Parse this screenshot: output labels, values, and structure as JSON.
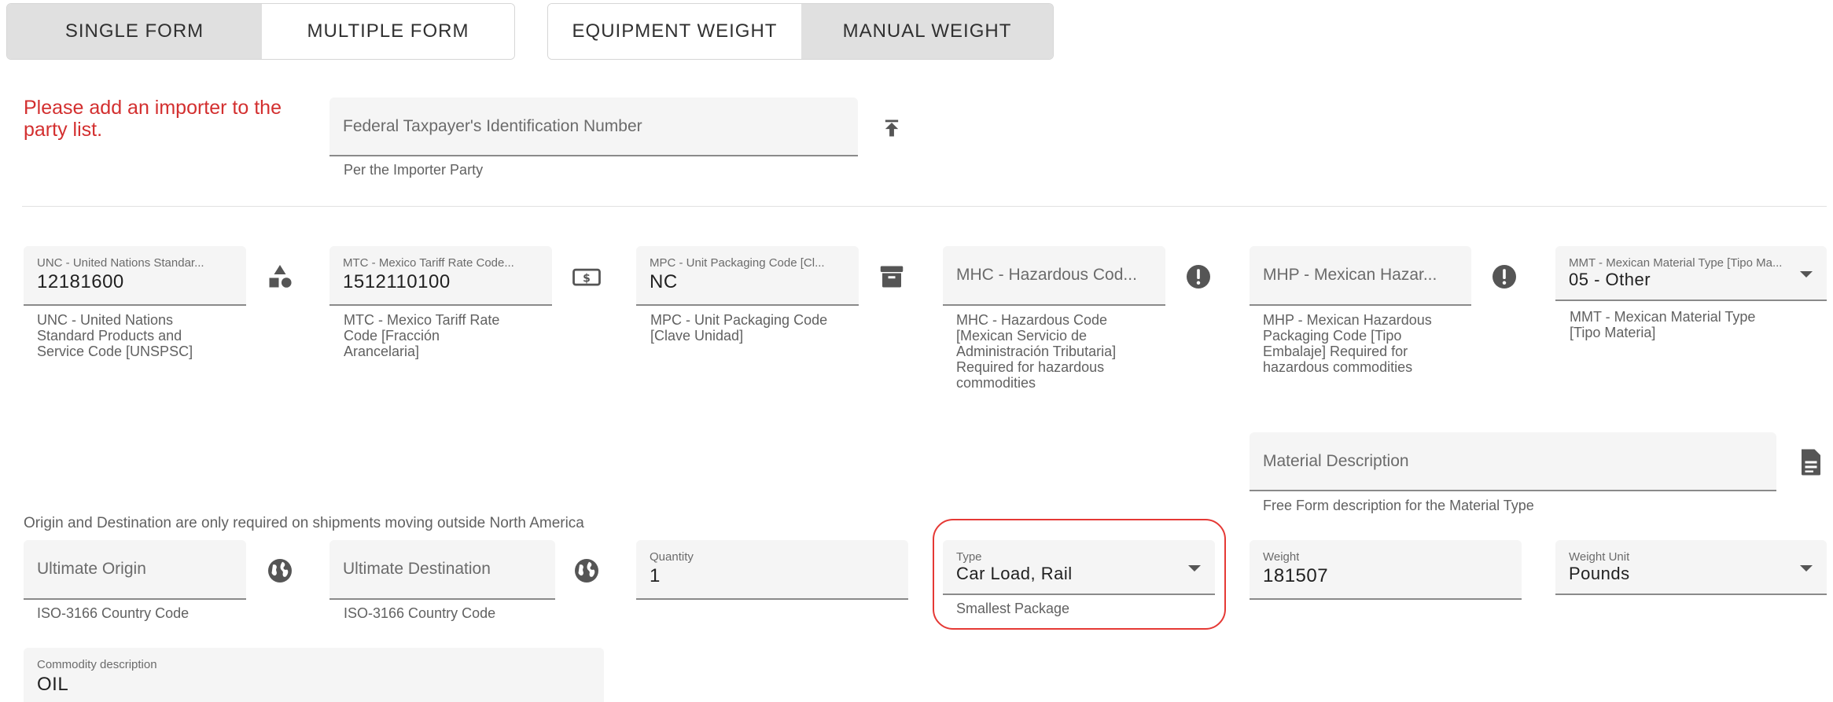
{
  "form_mode": {
    "single": "SINGLE FORM",
    "multiple": "MULTIPLE FORM"
  },
  "weight_mode": {
    "equipment": "EQUIPMENT WEIGHT",
    "manual": "MANUAL WEIGHT"
  },
  "importer_warning": "Please add an importer to the party list.",
  "taxpayer": {
    "placeholder": "Federal Taxpayer's Identification Number",
    "helper": "Per the Importer Party",
    "upload_icon": "upload-icon"
  },
  "unc": {
    "label": "UNC - United Nations Standar...",
    "value": "12181600",
    "helper": "UNC - United Nations Standard Products and Service Code [UNSPSC]",
    "icon": "shapes-icon"
  },
  "mtc": {
    "label": "MTC - Mexico Tariff Rate Code...",
    "value": "1512110100",
    "helper": "MTC - Mexico Tariff Rate Code [Fracción Arancelaria]",
    "icon": "money-icon"
  },
  "mpc": {
    "label": "MPC - Unit Packaging Code [Cl...",
    "value": "NC",
    "helper": "MPC - Unit Packaging Code [Clave Unidad]",
    "icon": "archive-icon"
  },
  "mhc": {
    "placeholder": "MHC - Hazardous Cod...",
    "helper": "MHC - Hazardous Code [Mexican Servicio de Administración Tributaria] Required for hazardous commodities",
    "icon": "alert-icon"
  },
  "mhp": {
    "placeholder": "MHP - Mexican Hazar...",
    "helper": "MHP - Mexican Hazardous Packaging Code [Tipo Embalaje] Required for hazardous commodities",
    "icon": "alert-icon"
  },
  "mmt": {
    "label": "MMT - Mexican Material Type [Tipo Ma...",
    "value": "05 - Other",
    "helper": "MMT - Mexican Material Type [Tipo Materia]"
  },
  "material": {
    "placeholder": "Material Description",
    "helper": "Free Form description for the Material Type",
    "icon": "document-icon"
  },
  "origin_note": "Origin and Destination are only required on shipments moving outside North America",
  "origin": {
    "placeholder": "Ultimate Origin",
    "helper": "ISO-3166 Country Code",
    "icon": "globe-icon"
  },
  "destination": {
    "placeholder": "Ultimate Destination",
    "helper": "ISO-3166 Country Code",
    "icon": "globe-icon"
  },
  "quantity": {
    "label": "Quantity",
    "value": "1"
  },
  "type": {
    "label": "Type",
    "value": "Car Load, Rail",
    "helper": "Smallest Package"
  },
  "weight": {
    "label": "Weight",
    "value": "181507"
  },
  "weight_unit": {
    "label": "Weight Unit",
    "value": "Pounds"
  },
  "commodity": {
    "label": "Commodity description",
    "value": "OIL"
  },
  "colors": {
    "warning": "#d32f2f",
    "highlight": "#e53935"
  }
}
